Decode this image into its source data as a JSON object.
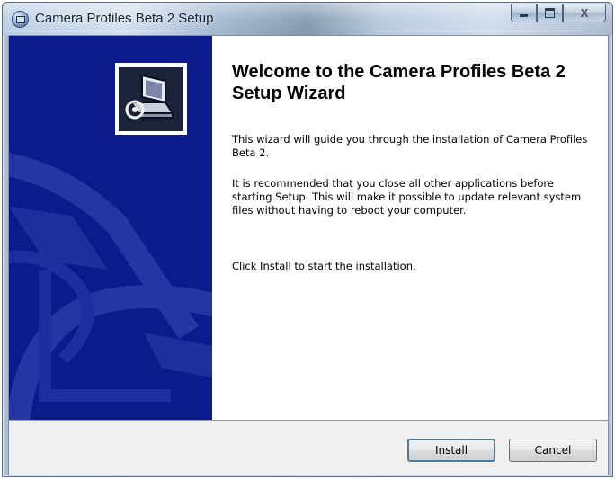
{
  "window": {
    "title": "Camera Profiles Beta 2 Setup",
    "icon": "setup-disc-icon",
    "controls": {
      "minimize_icon": "minimize-icon",
      "maximize_icon": "maximize-icon",
      "close_glyph": "X"
    }
  },
  "sidebar": {
    "background_color": "#0d1a8c",
    "logo_icon": "computer-install-icon"
  },
  "content": {
    "heading": "Welcome to the Camera Profiles Beta 2 Setup Wizard",
    "paragraphs": [
      "This wizard will guide you through the installation of Camera Profiles Beta 2.",
      "It is recommended that you close all other applications before starting Setup. This will make it possible to update relevant system files without having to reboot your computer.",
      "Click Install to start the installation."
    ]
  },
  "footer": {
    "install_label": "Install",
    "cancel_label": "Cancel"
  }
}
